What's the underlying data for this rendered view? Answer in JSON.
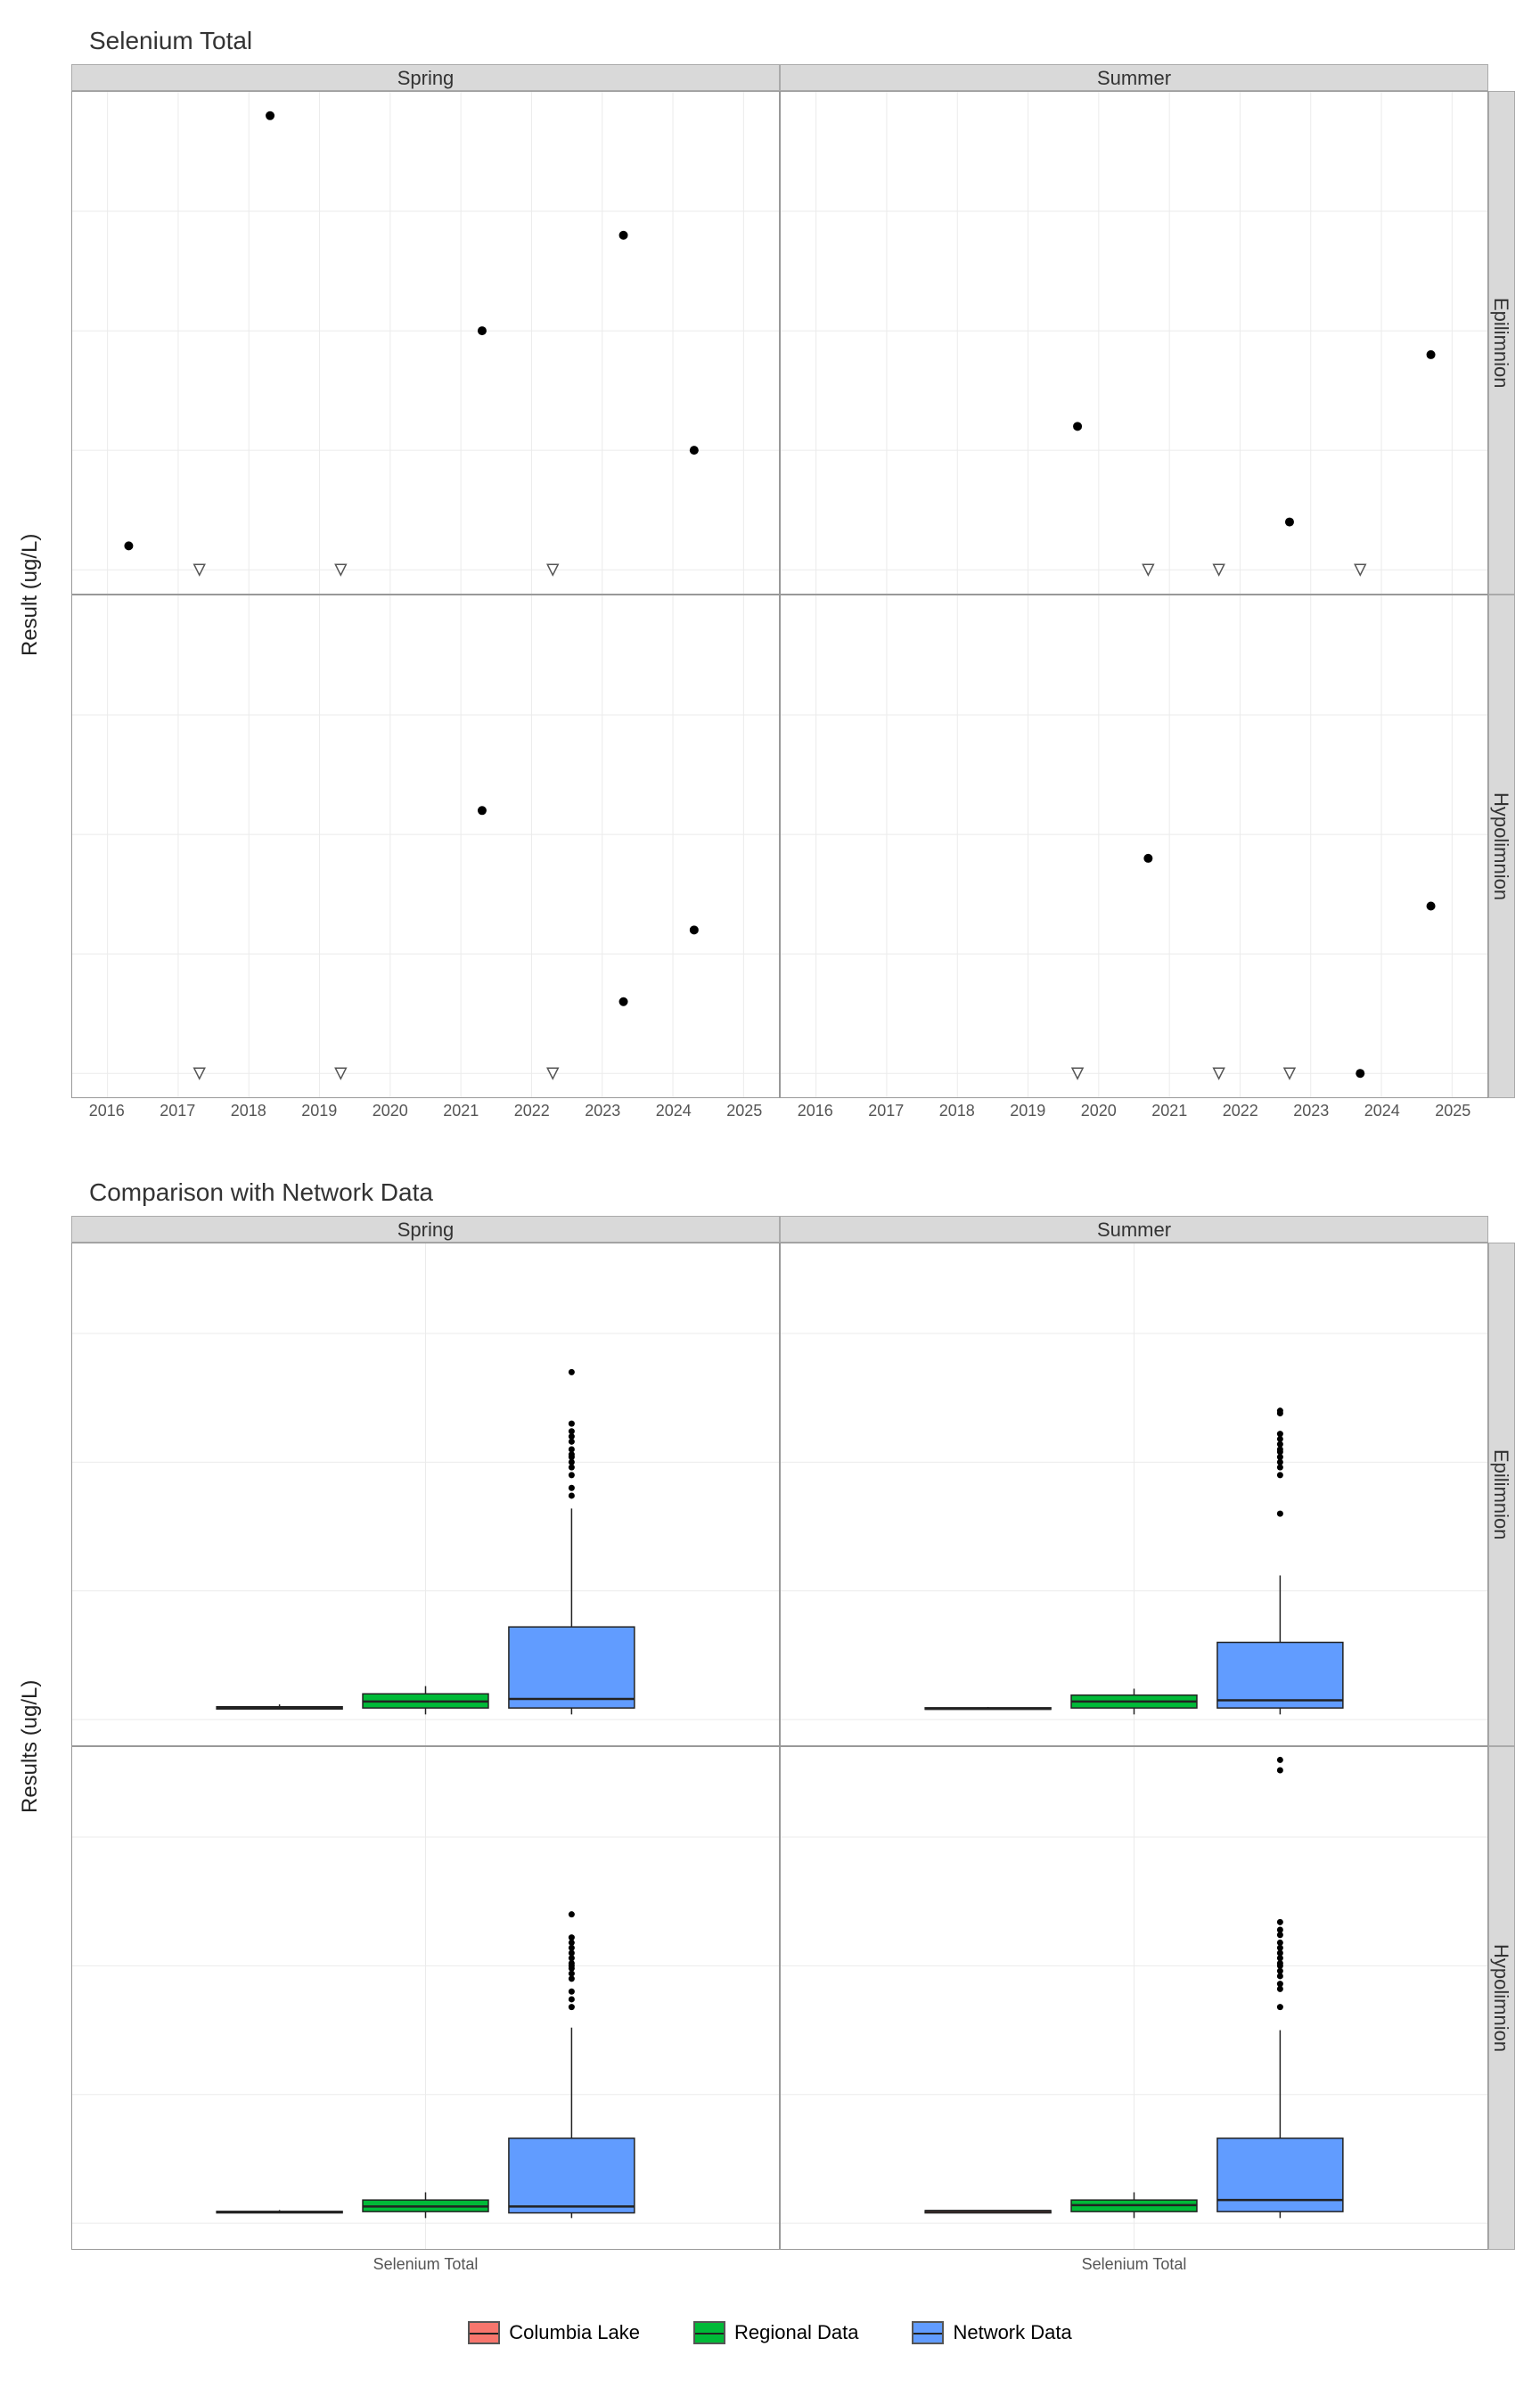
{
  "chart_data": [
    {
      "type": "scatter",
      "title": "Selenium Total",
      "ylabel": "Result (ug/L)",
      "xlabel": "",
      "facets_cols": [
        "Spring",
        "Summer"
      ],
      "facets_rows": [
        "Epilimnion",
        "Hypolimnion"
      ],
      "x_ticks": [
        2016,
        2017,
        2018,
        2019,
        2020,
        2021,
        2022,
        2023,
        2024,
        2025
      ],
      "y_ticks": [
        0.04,
        0.045,
        0.05,
        0.055
      ],
      "ylim": [
        0.039,
        0.06
      ],
      "xlim": [
        2015.5,
        2025.5
      ],
      "panels": {
        "Spring|Epilimnion": {
          "solid": [
            {
              "x": 2016.3,
              "y": 0.041
            },
            {
              "x": 2018.3,
              "y": 0.059
            },
            {
              "x": 2021.3,
              "y": 0.05
            },
            {
              "x": 2023.3,
              "y": 0.054
            },
            {
              "x": 2024.3,
              "y": 0.045
            }
          ],
          "open": [
            {
              "x": 2017.3,
              "y": 0.04
            },
            {
              "x": 2019.3,
              "y": 0.04
            },
            {
              "x": 2022.3,
              "y": 0.04
            }
          ]
        },
        "Summer|Epilimnion": {
          "solid": [
            {
              "x": 2019.7,
              "y": 0.046
            },
            {
              "x": 2022.7,
              "y": 0.042
            },
            {
              "x": 2024.7,
              "y": 0.049
            }
          ],
          "open": [
            {
              "x": 2020.7,
              "y": 0.04
            },
            {
              "x": 2021.7,
              "y": 0.04
            },
            {
              "x": 2023.7,
              "y": 0.04
            }
          ]
        },
        "Spring|Hypolimnion": {
          "solid": [
            {
              "x": 2021.3,
              "y": 0.051
            },
            {
              "x": 2023.3,
              "y": 0.043
            },
            {
              "x": 2024.3,
              "y": 0.046
            }
          ],
          "open": [
            {
              "x": 2017.3,
              "y": 0.04
            },
            {
              "x": 2019.3,
              "y": 0.04
            },
            {
              "x": 2022.3,
              "y": 0.04
            }
          ]
        },
        "Summer|Hypolimnion": {
          "solid": [
            {
              "x": 2020.7,
              "y": 0.049
            },
            {
              "x": 2023.7,
              "y": 0.04
            },
            {
              "x": 2024.7,
              "y": 0.047
            }
          ],
          "open": [
            {
              "x": 2019.7,
              "y": 0.04
            },
            {
              "x": 2021.7,
              "y": 0.04
            },
            {
              "x": 2022.7,
              "y": 0.04
            }
          ]
        }
      }
    },
    {
      "type": "box",
      "title": "Comparison with Network Data",
      "ylabel": "Results (ug/L)",
      "xlabel": "",
      "facets_cols": [
        "Spring",
        "Summer"
      ],
      "facets_rows": [
        "Epilimnion",
        "Hypolimnion"
      ],
      "x_category": "Selenium Total",
      "y_ticks": [
        0.0,
        0.5,
        1.0,
        1.5
      ],
      "ylim": [
        -0.1,
        1.85
      ],
      "groups": [
        "Columbia Lake",
        "Regional Data",
        "Network Data"
      ],
      "colors": {
        "Columbia Lake": "#F8766D",
        "Regional Data": "#00BA38",
        "Network Data": "#619CFF"
      },
      "panels": {
        "Spring|Epilimnion": {
          "Columbia Lake": {
            "min": 0.04,
            "q1": 0.041,
            "med": 0.045,
            "q3": 0.05,
            "max": 0.059,
            "out": []
          },
          "Regional Data": {
            "min": 0.02,
            "q1": 0.045,
            "med": 0.07,
            "q3": 0.1,
            "max": 0.13,
            "out": []
          },
          "Network Data": {
            "min": 0.02,
            "q1": 0.045,
            "med": 0.08,
            "q3": 0.36,
            "max": 0.82,
            "out": [
              0.87,
              0.9,
              0.95,
              0.98,
              1.0,
              1.02,
              1.03,
              1.05,
              1.08,
              1.1,
              1.12,
              1.15,
              1.35
            ]
          }
        },
        "Summer|Epilimnion": {
          "Columbia Lake": {
            "min": 0.04,
            "q1": 0.04,
            "med": 0.042,
            "q3": 0.046,
            "max": 0.049,
            "out": []
          },
          "Regional Data": {
            "min": 0.02,
            "q1": 0.045,
            "med": 0.07,
            "q3": 0.095,
            "max": 0.12,
            "out": []
          },
          "Network Data": {
            "min": 0.02,
            "q1": 0.045,
            "med": 0.075,
            "q3": 0.3,
            "max": 0.56,
            "out": [
              0.8,
              0.95,
              0.98,
              1.0,
              1.02,
              1.04,
              1.05,
              1.07,
              1.09,
              1.11,
              1.19,
              1.2
            ]
          }
        },
        "Spring|Hypolimnion": {
          "Columbia Lake": {
            "min": 0.04,
            "q1": 0.04,
            "med": 0.043,
            "q3": 0.046,
            "max": 0.051,
            "out": []
          },
          "Regional Data": {
            "min": 0.02,
            "q1": 0.045,
            "med": 0.065,
            "q3": 0.09,
            "max": 0.12,
            "out": []
          },
          "Network Data": {
            "min": 0.02,
            "q1": 0.04,
            "med": 0.065,
            "q3": 0.33,
            "max": 0.76,
            "out": [
              0.84,
              0.87,
              0.9,
              0.95,
              0.97,
              0.99,
              1.0,
              1.01,
              1.03,
              1.05,
              1.07,
              1.09,
              1.11,
              1.2
            ]
          }
        },
        "Summer|Hypolimnion": {
          "Columbia Lake": {
            "min": 0.04,
            "q1": 0.04,
            "med": 0.047,
            "q3": 0.049,
            "max": 0.049,
            "out": []
          },
          "Regional Data": {
            "min": 0.02,
            "q1": 0.045,
            "med": 0.07,
            "q3": 0.09,
            "max": 0.12,
            "out": []
          },
          "Network Data": {
            "min": 0.02,
            "q1": 0.045,
            "med": 0.09,
            "q3": 0.33,
            "max": 0.75,
            "out": [
              0.84,
              0.91,
              0.93,
              0.96,
              0.98,
              1.0,
              1.01,
              1.03,
              1.05,
              1.07,
              1.09,
              1.12,
              1.14,
              1.17,
              1.76,
              1.8
            ]
          }
        }
      }
    }
  ],
  "legend": {
    "items": [
      {
        "label": "Columbia Lake",
        "color": "#F8766D"
      },
      {
        "label": "Regional Data",
        "color": "#00BA38"
      },
      {
        "label": "Network Data",
        "color": "#619CFF"
      }
    ]
  }
}
